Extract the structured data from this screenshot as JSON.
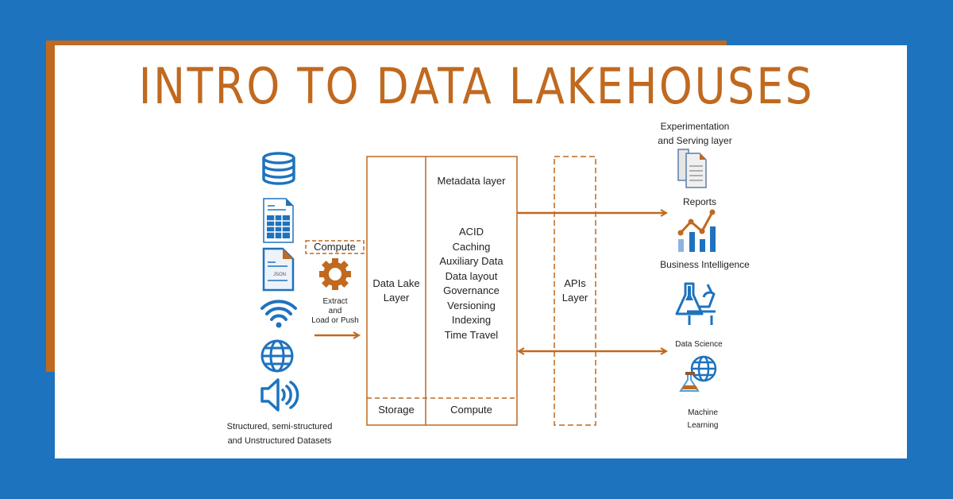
{
  "title": "INTRO TO DATA LAKEHOUSES",
  "colors": {
    "background": "#1e73be",
    "accent": "#c0691f",
    "icon_blue": "#1e73be",
    "panel": "#ffffff"
  },
  "sources": {
    "icons": [
      "database-icon",
      "spreadsheet-icon",
      "json-file-icon",
      "wifi-icon",
      "globe-icon",
      "speaker-icon"
    ],
    "json_label": "JSON",
    "caption_line1": "Structured, semi-structured",
    "caption_line2": "and Unstructured Datasets"
  },
  "compute": {
    "label": "Compute",
    "extract_line1": "Extract",
    "extract_line2": "and",
    "extract_line3": "Load or Push"
  },
  "lakehouse": {
    "data_lake_line1": "Data Lake",
    "data_lake_line2": "Layer",
    "metadata_title": "Metadata layer",
    "features": [
      "ACID",
      "Caching",
      "Auxiliary Data",
      "Data layout",
      "Governance",
      "Versioning",
      "Indexing",
      "Time Travel"
    ],
    "storage": "Storage",
    "compute": "Compute"
  },
  "apis": {
    "line1": "APIs",
    "line2": "Layer"
  },
  "consumers": {
    "header_line1": "Experimentation",
    "header_line2": "and Serving layer",
    "reports": "Reports",
    "bi": "Business Intelligence",
    "data_science": "Data Science",
    "ml_line1": "Machine",
    "ml_line2": "Learning"
  }
}
